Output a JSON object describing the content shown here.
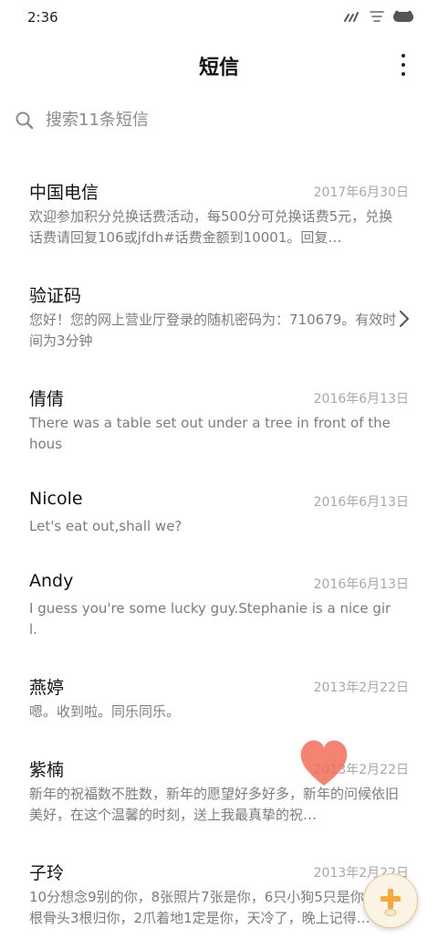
{
  "status_bar": {
    "time": "2:36",
    "icons": [
      "signal-icon",
      "wifi-icon",
      "battery-icon"
    ]
  },
  "header": {
    "title": "短信",
    "more_icon": "more-vertical-icon"
  },
  "search": {
    "placeholder": "搜索11条短信",
    "value": ""
  },
  "messages": [
    {
      "name": "中国电信",
      "date": "2017年6月30日",
      "preview": "欢迎参加积分兑换话费活动，每500分可兑换话费5元，兑换话费请回复106或jfdh#话费金额到10001。回复…"
    },
    {
      "name": "验证码",
      "date": "",
      "preview": "您好！您的网上营业厅登录的随机密码为：710679。有效时间为3分钟",
      "has_chevron": true
    },
    {
      "name": "倩倩",
      "date": "2016年6月13日",
      "preview": "There was a table set out under a tree in front of the hous"
    },
    {
      "name": "Nicole",
      "date": "2016年6月13日",
      "preview": "Let's eat out,shall we?"
    },
    {
      "name": "Andy",
      "date": "2016年6月13日",
      "preview": "I guess you're some lucky guy.Stephanie is a nice girl."
    },
    {
      "name": "燕婷",
      "date": "2013年2月22日",
      "preview": "嗯。收到啦。同乐同乐。"
    },
    {
      "name": "紫楠",
      "date": "2013年2月22日",
      "preview": "新年的祝福数不胜数，新年的愿望好多好多，新年的问候依旧美好，在这个温馨的时刻，送上我最真挚的祝…"
    },
    {
      "name": "子玲",
      "date": "2013年2月22日",
      "preview": "10分想念9别的你，8张照片7张是你，6只小狗5只是你，4根骨头3根归你，2爪着地1定是你，天冷了，晚上记得…"
    }
  ],
  "colors": {
    "accent_compose": "#f3a93b",
    "heart": "#f26d5b",
    "secondary_text": "#7c7c7c",
    "date_text": "#a8a8a8"
  },
  "compose_icon": "plus-icon"
}
